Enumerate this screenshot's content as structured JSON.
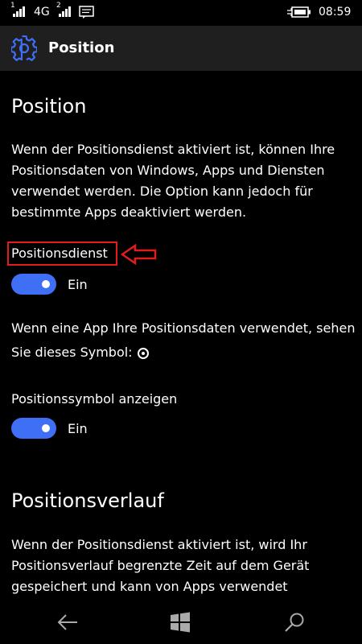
{
  "status": {
    "sim1": "1",
    "network": "4G",
    "sim2": "2",
    "time": "08:59"
  },
  "header": {
    "title": "Position"
  },
  "main": {
    "heading": "Position",
    "description": "Wenn der Positionsdienst aktiviert ist, können Ihre Positionsdaten von Windows, Apps und Diensten verwendet werden. Die Option kann jedoch für bestimmte Apps deaktiviert werden.",
    "service_label": "Positionsdienst",
    "service_state": "Ein",
    "symbol_text": "Wenn eine App Ihre Positionsdaten verwendet, sehen Sie dieses Symbol:",
    "symbol_label": "Positionssymbol anzeigen",
    "symbol_state": "Ein",
    "history_heading": "Positionsverlauf",
    "history_text": "Wenn der Positionsdienst aktiviert ist, wird Ihr Positionsverlauf begrenzte Zeit auf dem Gerät gespeichert und kann von Apps verwendet"
  },
  "colors": {
    "accent": "#3e6ff5",
    "highlight": "#e21b1b",
    "header_bg": "#1f1f1f"
  }
}
